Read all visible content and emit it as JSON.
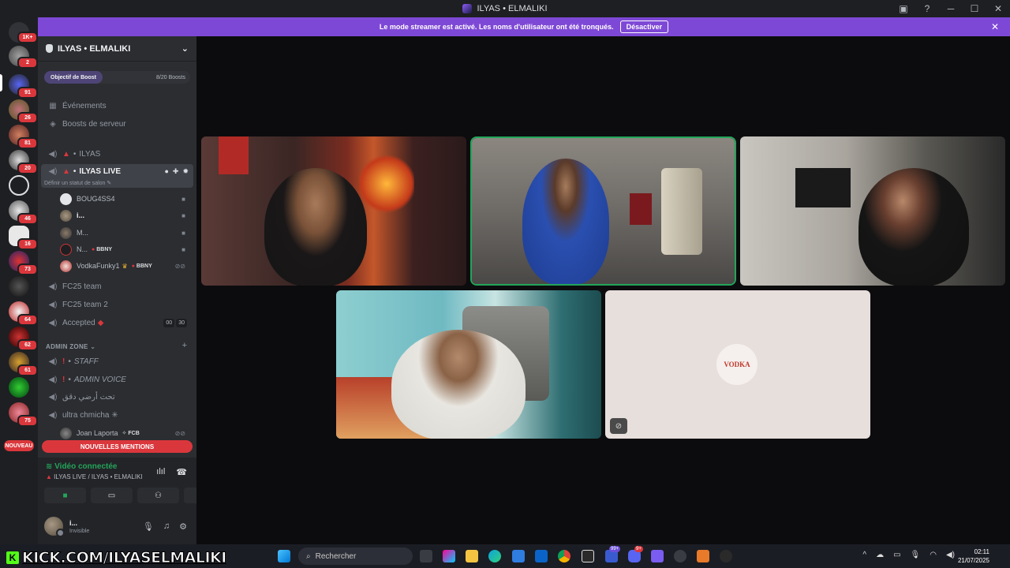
{
  "window": {
    "title": "ILYAS • ELMALIKI"
  },
  "rail": {
    "badges": [
      "1K+",
      "2",
      "91",
      "26",
      "81",
      "20",
      "46",
      "16",
      "73",
      "64",
      "62",
      "61",
      "75"
    ],
    "new_label": "NOUVEAU"
  },
  "banner": {
    "text": "Le mode streamer est activé. Les noms d'utilisateur ont été tronqués.",
    "button": "Désactiver"
  },
  "server": {
    "name": "ILYAS • ELMALIKI",
    "boost_goal": "Objectif de Boost",
    "boost_count": "8/20 Boosts"
  },
  "nav": {
    "events": "Événements",
    "boosts": "Boosts de serveur"
  },
  "channels": {
    "ilyas": "ILYAS",
    "ilyas_live": "ILYAS LIVE",
    "status_hint": "Définir un statut de salon",
    "fc25_team": "FC25 team",
    "fc25_team2": "FC25 team 2",
    "accepted": "Accepted",
    "accepted_counts": [
      "00",
      "30"
    ],
    "admin_zone": "ADMIN ZONE",
    "staff": "STAFF",
    "admin_voice": "ADMIN VOICE",
    "arabic": "تحت أرضي دقق",
    "ultra": "ultra chmicha ✳"
  },
  "members": [
    {
      "name": "BOUG4SS4",
      "tag": ""
    },
    {
      "name": "i...",
      "tag": ""
    },
    {
      "name": "M...",
      "tag": ""
    },
    {
      "name": "N...",
      "tag": "BBNY"
    },
    {
      "name": "VodkaFunky1",
      "tag": "BBNY"
    }
  ],
  "admin_member": {
    "name": "Joan Laporta",
    "tag": "FCB"
  },
  "mentions_label": "NOUVELLES MENTIONS",
  "voice": {
    "status": "Vidéo connectée",
    "channel": "ILYAS LIVE / ILYAS • ELMALIKI"
  },
  "user": {
    "name": "i...",
    "status": "Invisible"
  },
  "video": {
    "logo_text": "VODKA"
  },
  "taskbar": {
    "search_placeholder": "Rechercher",
    "badge_chrome": "99+",
    "badge_discord": "9+",
    "time": "02:11",
    "date": "21/07/2025"
  },
  "overlay": {
    "kick_url": "KICK.COM/ILYASELMALIKI"
  },
  "colors": {
    "accent": "#7e48d6",
    "danger": "#da373c",
    "online": "#23a55a",
    "sidebar": "#2b2d31",
    "rail": "#1e1f22"
  }
}
